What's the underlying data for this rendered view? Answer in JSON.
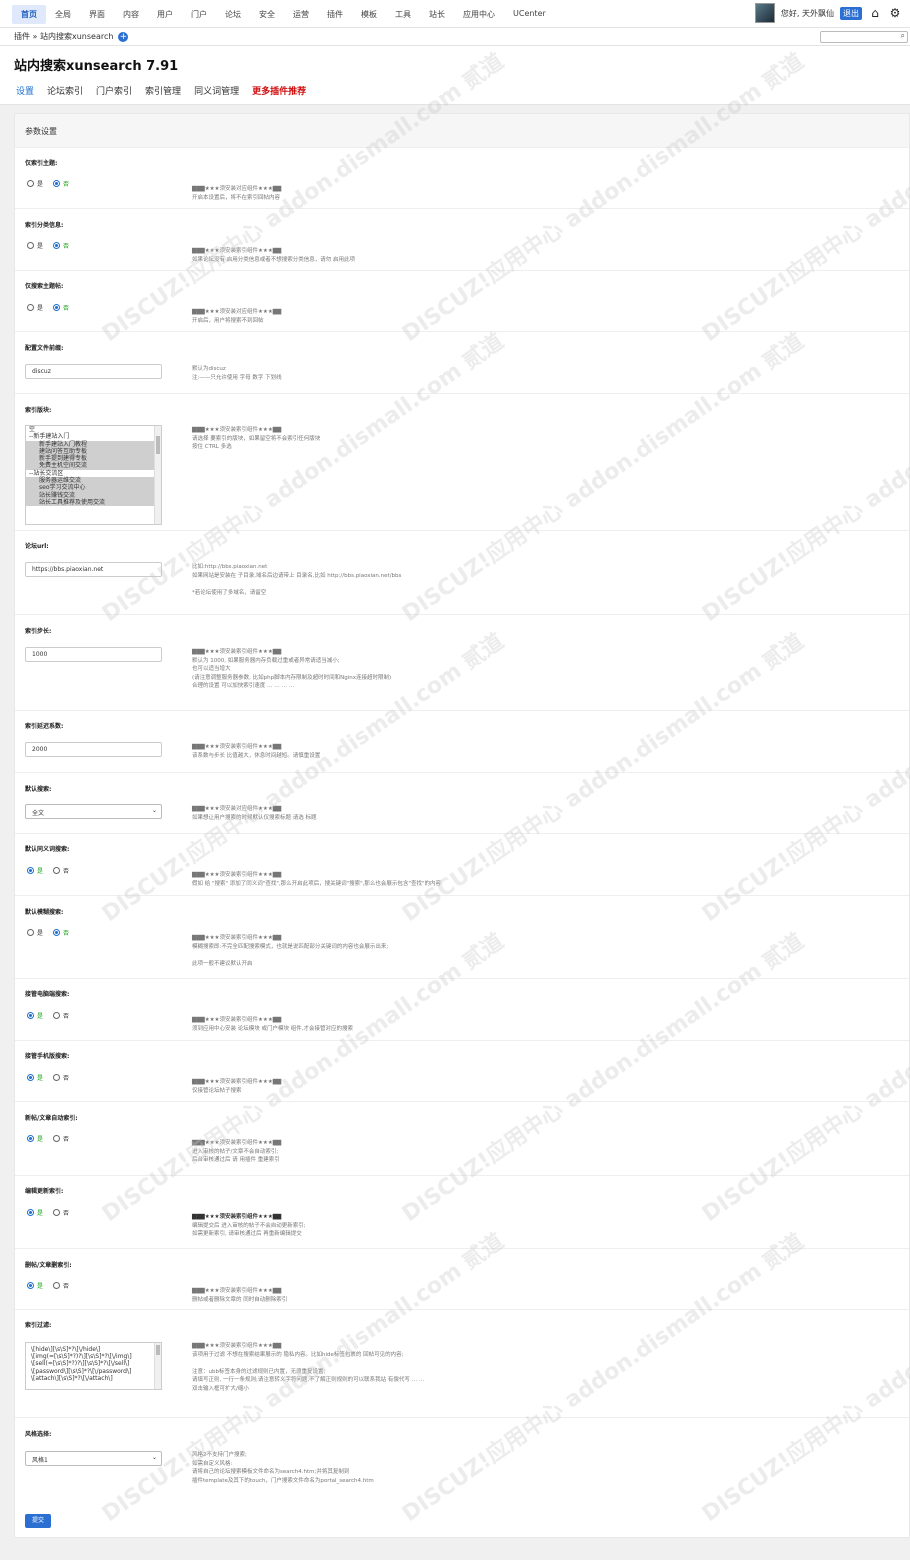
{
  "nav": {
    "items": [
      "首页",
      "全局",
      "界面",
      "内容",
      "用户",
      "门户",
      "论坛",
      "安全",
      "运营",
      "插件",
      "模板",
      "工具",
      "站长",
      "应用中心",
      "UCenter"
    ],
    "active_index": 0,
    "greeting": "您好, 天外飘仙",
    "logout": "退出",
    "icons": [
      "home-icon",
      "gear-icon"
    ]
  },
  "breadcrumb": {
    "text": "插件 » 站内搜索xunsearch"
  },
  "header": {
    "title": "站内搜索xunsearch 7.91",
    "tabs": [
      "设置",
      "论坛索引",
      "门户索引",
      "索引管理",
      "同义词管理",
      "更多插件推荐"
    ],
    "active_tab": 0
  },
  "panel": {
    "title": "参数设置"
  },
  "settings": {
    "s1": {
      "label": "仅索引主题:",
      "yes": "是",
      "no": "否",
      "selected": "否",
      "desc": [
        "▇▇▇★★★须安装对应组件★★★▇▇",
        "开启本设置后，将不在索引回帖内容"
      ]
    },
    "s2": {
      "label": "索引分类信息:",
      "yes": "是",
      "no": "否",
      "selected": "否",
      "desc": [
        "▇▇▇★★★须安装索引组件★★★▇▇",
        "如果论坛没有 启用分类信息或者不想搜索分类信息，请勿 启用此项"
      ]
    },
    "s3": {
      "label": "仅搜索主题帖:",
      "yes": "是",
      "no": "否",
      "selected": "否",
      "desc": [
        "▇▇▇★★★须安装对应组件★★★▇▇",
        "开启后，用户将搜索不到回帖"
      ]
    },
    "s4": {
      "label": "配置文件前缀:",
      "value": "discuz",
      "desc": [
        "默认为discuz",
        "注:——只允许使用 字母 数字 下划线"
      ]
    },
    "s5": {
      "label": "索引版块:",
      "options": [
        "空",
        "--新手建站入门",
        "新手建站入门教程",
        "建站问答互助专板",
        "新手提到建得专板",
        "免费主机空间交流",
        "--站长交流区",
        "服务器运维交流",
        "seo学习交流中心",
        "站长赚钱交流",
        "站长工具推荐及使用交流"
      ],
      "desc": [
        "▇▇▇★★★须安装索引组件★★★▇▇",
        "请选择 要索引的版块，如果留空将不会索引任何版块",
        "按住 CTRL 多选"
      ]
    },
    "s6": {
      "label": "论坛url:",
      "value": "https://bbs.piaoxian.net",
      "desc": [
        "比如:http://bbs.piaoxian.net",
        "如果网站是安装在 子目录,域名后边请带上 目录名,比如 http://bbs.piaoxian.net/bbs",
        "",
        "*若论坛使用了多域名，请留空"
      ]
    },
    "s7": {
      "label": "索引步长:",
      "value": "1000",
      "desc": [
        "▇▇▇★★★须安装索引组件★★★▇▇",
        "默认为 1000, 如果服务器内存负载过重或者异常请适当减小;",
        "也可以适当增大",
        "(请注意调整服务器参数, 比如php脚本内存限制及超时时间和Nginx连接超时限制)",
        "合理的设置 可以加快索引速度 … … … …"
      ]
    },
    "s8": {
      "label": "索引延迟系数:",
      "value": "2000",
      "desc": [
        "▇▇▇★★★须安装索引组件★★★▇▇",
        "该系数与步长 比值越大，休息时间越短。请慎重设置"
      ]
    },
    "s9": {
      "label": "默认搜索:",
      "value": "全文",
      "desc": [
        "▇▇▇★★★须安装对应组件★★★▇▇",
        "如果想让用户搜索的时候默认仅搜索标题 请选 标题"
      ]
    },
    "s10": {
      "label": "默认同义词搜索:",
      "yes": "是",
      "no": "否",
      "selected": "是",
      "desc": [
        "▇▇▇★★★须安装索引组件★★★▇▇",
        "假如 给 \"搜索\" 添加了同义词\"查找\",那么开启此项后，搜关键词\"搜索\",那么也会展示包含\"查找\"的内容"
      ]
    },
    "s11": {
      "label": "默认模糊搜索:",
      "yes": "是",
      "no": "否",
      "selected": "否",
      "desc": [
        "▇▇▇★★★须安装索引组件★★★▇▇",
        "模糊搜索即:不完全匹配搜索模式，也就是说匹配部分关键词的内容也会展示出来;",
        "",
        "此项一般不建议默认开启"
      ]
    },
    "s12": {
      "label": "接管电脑端搜索:",
      "yes": "是",
      "no": "否",
      "selected": "是",
      "desc": [
        "▇▇▇★★★须安装索引组件★★★▇▇",
        "须到应用中心安装 论坛模块 或门户模块 组件,才会接管对应的搜索"
      ]
    },
    "s13": {
      "label": "接管手机版搜索:",
      "yes": "是",
      "no": "否",
      "selected": "是",
      "desc": [
        "▇▇▇★★★须安装索引组件★★★▇▇",
        "仅接管论坛帖子搜索"
      ]
    },
    "s14": {
      "label": "新帖/文章自动索引:",
      "yes": "是",
      "no": "否",
      "selected": "是",
      "desc": [
        "▇▇▇★★★须安装索引组件★★★▇▇",
        "进入审核的帖子/文章不会自动索引;",
        "后台审核通过后 请 用插件 重建索引"
      ]
    },
    "s15": {
      "label": "编辑更新索引:",
      "yes": "是",
      "no": "否",
      "selected": "是",
      "desc": [
        "▇▇▇★★★须安装索引组件★★★▇▇",
        "编辑提交后 进入审核的帖子不会自动更新索引;",
        "如需更新索引, 请审核通过后 再重新编辑提交"
      ]
    },
    "s16": {
      "label": "删帖/文章删索引:",
      "yes": "是",
      "no": "否",
      "selected": "是",
      "desc": [
        "▇▇▇★★★须安装索引组件★★★▇▇",
        "删帖或者删除文章的 同时自动删除索引"
      ]
    },
    "s17": {
      "label": "索引过滤:",
      "lines": [
        "\\[hide\\][\\s\\S]*?\\[\\/hide\\]",
        "\\[img(=[\\s\\S]*?)?\\][\\s\\S]*?\\[\\/img\\]",
        "\\[sell(=[\\s\\S]*?)?\\][\\s\\S]*?\\[\\/sell\\]",
        "\\[password\\][\\s\\S]*?\\[\\/password\\]",
        "\\[attach\\][\\s\\S]*?\\[\\/attach\\]"
      ],
      "desc": [
        "▇▇▇★★★须安装索引组件★★★▇▇",
        "该项用于过滤 不想在搜索结果展示的 隐私内容。比如hide标签包裹的 回帖可见的内容;",
        "",
        "注意：ubb标签本身的过滤规则已内置，无须重复设置;",
        "请填写正则, 一行一条规则;请注意转义字符问题,不了解正则规则的可以联系我站 有偿代写 … …",
        "双击输入框可扩大/缩小"
      ]
    },
    "s18": {
      "label": "风格选择:",
      "value": "风格1",
      "desc": [
        "风格2不支持门户搜索;",
        "如需自定义风格:",
        "请将自己的论坛搜索模板文件命名为search4.htm;并将其复制到",
        "插件template及其下的touch，门户搜索文件命名为portal_search4.htm"
      ]
    }
  },
  "submit_label": "提交",
  "watermark": "DISCUZ!应用中心 addon.dismall.com 贰道"
}
